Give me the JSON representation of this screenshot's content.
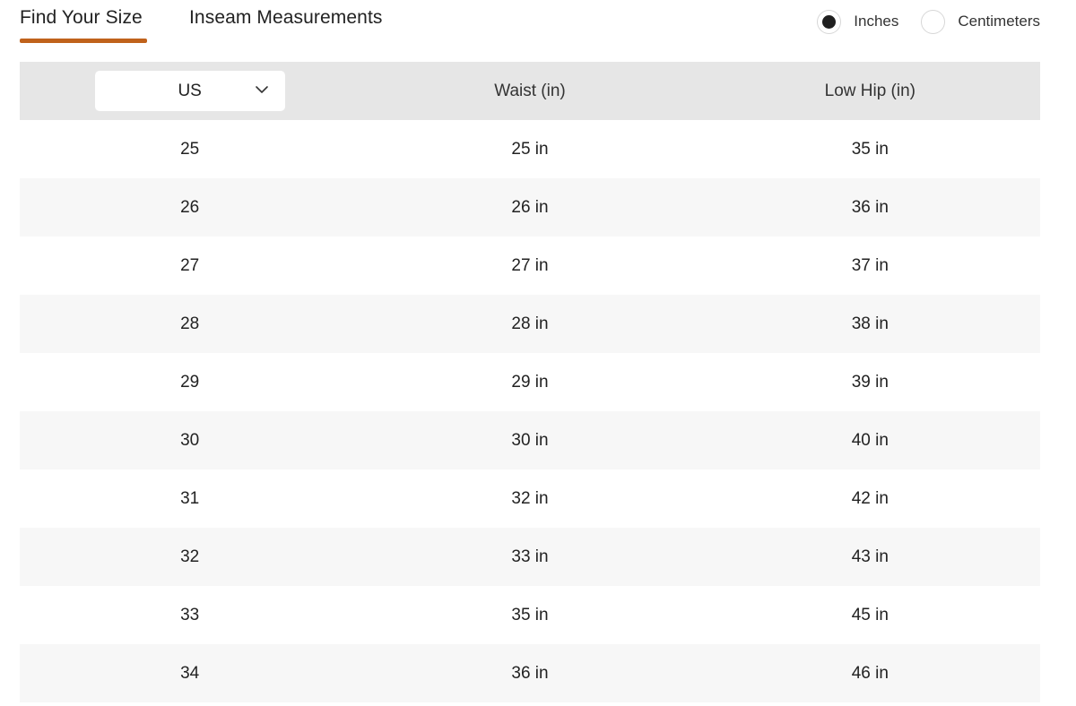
{
  "tabs": [
    {
      "label": "Find Your Size",
      "active": true
    },
    {
      "label": "Inseam Measurements",
      "active": false
    }
  ],
  "units": {
    "options": [
      {
        "label": "Inches",
        "selected": true
      },
      {
        "label": "Centimeters",
        "selected": false
      }
    ]
  },
  "table": {
    "size_system": {
      "value": "US",
      "icon": "chevron-down-icon"
    },
    "headers": [
      "Waist (in)",
      "Low Hip (in)"
    ],
    "rows": [
      {
        "size": "25",
        "waist": "25 in",
        "low_hip": "35 in"
      },
      {
        "size": "26",
        "waist": "26 in",
        "low_hip": "36 in"
      },
      {
        "size": "27",
        "waist": "27 in",
        "low_hip": "37 in"
      },
      {
        "size": "28",
        "waist": "28 in",
        "low_hip": "38 in"
      },
      {
        "size": "29",
        "waist": "29 in",
        "low_hip": "39 in"
      },
      {
        "size": "30",
        "waist": "30 in",
        "low_hip": "40 in"
      },
      {
        "size": "31",
        "waist": "32 in",
        "low_hip": "42 in"
      },
      {
        "size": "32",
        "waist": "33 in",
        "low_hip": "43 in"
      },
      {
        "size": "33",
        "waist": "35 in",
        "low_hip": "45 in"
      },
      {
        "size": "34",
        "waist": "36 in",
        "low_hip": "46 in"
      }
    ]
  },
  "colors": {
    "accent": "#c0621b",
    "header_bg": "#e6e6e6",
    "stripe_bg": "#f7f7f7",
    "text": "#222222"
  }
}
